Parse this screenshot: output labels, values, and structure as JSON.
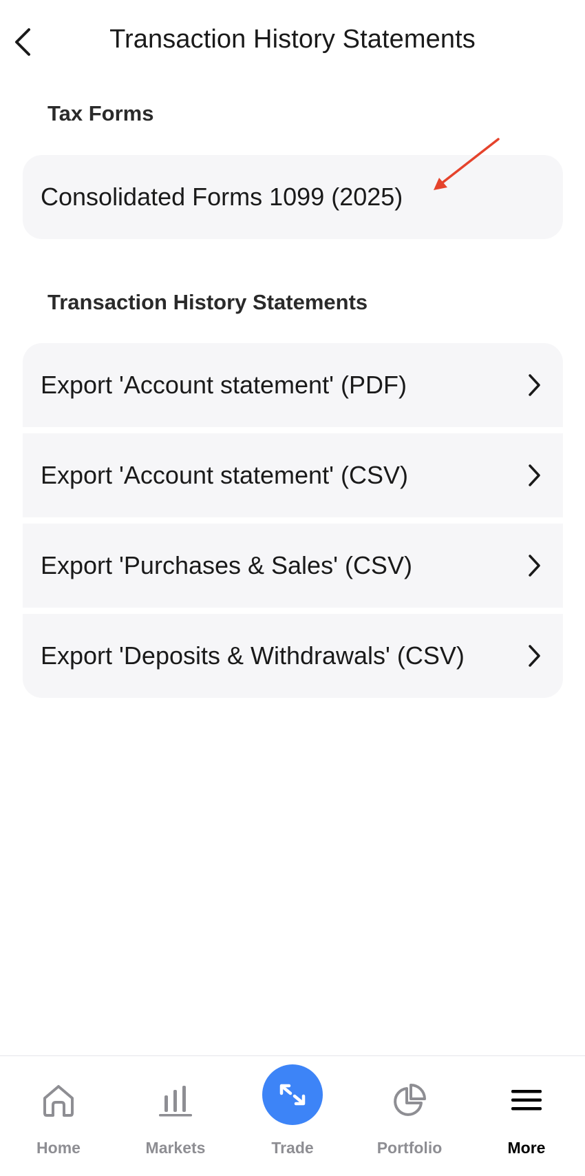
{
  "header": {
    "title": "Transaction History Statements",
    "back_icon": "chevron-left-icon"
  },
  "tax_section": {
    "title": "Tax Forms",
    "items": [
      {
        "label": "Consolidated Forms 1099 (2025)"
      }
    ]
  },
  "history_section": {
    "title": "Transaction History Statements",
    "items": [
      {
        "label": "Export 'Account statement' (PDF)",
        "icon": "chevron-right-icon"
      },
      {
        "label": "Export 'Account statement' (CSV)",
        "icon": "chevron-right-icon"
      },
      {
        "label": "Export 'Purchases & Sales' (CSV)",
        "icon": "chevron-right-icon"
      },
      {
        "label": "Export 'Deposits & Withdrawals' (CSV)",
        "icon": "chevron-right-icon"
      }
    ]
  },
  "annotation": {
    "type": "arrow",
    "color": "#e5432c"
  },
  "tabbar": {
    "active": "More",
    "accent_color": "#3d84f7",
    "tabs": [
      {
        "label": "Home",
        "icon": "home-icon"
      },
      {
        "label": "Markets",
        "icon": "bar-chart-icon"
      },
      {
        "label": "Trade",
        "icon": "trade-arrows-icon"
      },
      {
        "label": "Portfolio",
        "icon": "pie-chart-icon"
      },
      {
        "label": "More",
        "icon": "menu-icon"
      }
    ]
  }
}
